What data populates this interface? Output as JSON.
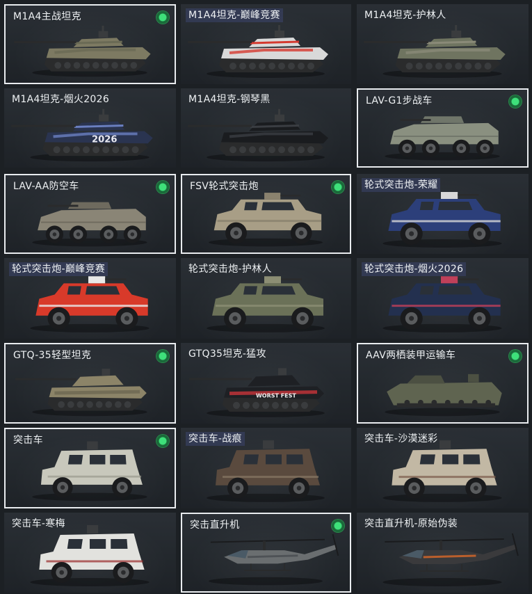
{
  "vehicles": [
    {
      "name": "M1A4主战坦克",
      "type": "tank",
      "owned": true,
      "selected": true,
      "special": false,
      "color": "#7d7a62",
      "accent": "#6a6a55"
    },
    {
      "name": "M1A4坦克-巅峰竞赛",
      "type": "tank",
      "owned": false,
      "selected": false,
      "special": true,
      "color": "#d9d9d9",
      "accent": "#d43a2f"
    },
    {
      "name": "M1A4坦克-护林人",
      "type": "tank",
      "owned": false,
      "selected": false,
      "special": false,
      "color": "#6f7460",
      "accent": "#8a8a78"
    },
    {
      "name": "M1A4坦克-烟火2026",
      "type": "tank",
      "owned": false,
      "selected": false,
      "special": false,
      "color": "#2a3450",
      "accent": "#6a7fc0",
      "decal": "2026"
    },
    {
      "name": "M1A4坦克-钢琴黑",
      "type": "tank",
      "owned": false,
      "selected": false,
      "special": false,
      "color": "#1a1c1f",
      "accent": "#3a3d42"
    },
    {
      "name": "LAV-G1步战车",
      "type": "apc8",
      "owned": true,
      "selected": true,
      "special": false,
      "color": "#8a9080",
      "accent": "#70766a"
    },
    {
      "name": "LAV-AA防空车",
      "type": "apc8",
      "owned": true,
      "selected": true,
      "special": false,
      "color": "#8a8576",
      "accent": "#6e6a5e"
    },
    {
      "name": "FSV轮式突击炮",
      "type": "armored4",
      "owned": true,
      "selected": true,
      "special": false,
      "color": "#a89e86",
      "accent": "#8a826e"
    },
    {
      "name": "轮式突击炮-荣耀",
      "type": "armored4",
      "owned": false,
      "selected": false,
      "special": true,
      "color": "#2c3f7a",
      "accent": "#d8d8d8"
    },
    {
      "name": "轮式突击炮-巅峰竞赛",
      "type": "armored4",
      "owned": false,
      "selected": false,
      "special": true,
      "color": "#d83a2a",
      "accent": "#e8e8e8"
    },
    {
      "name": "轮式突击炮-护林人",
      "type": "armored4",
      "owned": false,
      "selected": false,
      "special": false,
      "color": "#6b7158",
      "accent": "#8c8e74"
    },
    {
      "name": "轮式突击炮-烟火2026",
      "type": "armored4",
      "owned": false,
      "selected": false,
      "special": true,
      "color": "#23304f",
      "accent": "#c0405a"
    },
    {
      "name": "GTQ-35轻型坦克",
      "type": "lighttank",
      "owned": true,
      "selected": true,
      "special": false,
      "color": "#8c8468",
      "accent": "#6e6852"
    },
    {
      "name": "GTQ35坦克-猛攻",
      "type": "lighttank",
      "owned": false,
      "selected": false,
      "special": false,
      "color": "#1e2024",
      "accent": "#c8343a",
      "decal": "WORST FEST"
    },
    {
      "name": "AAV两栖装甲运输车",
      "type": "amphib",
      "owned": true,
      "selected": true,
      "special": false,
      "color": "#5f6450",
      "accent": "#4c5042"
    },
    {
      "name": "突击车",
      "type": "mrap",
      "owned": true,
      "selected": true,
      "special": false,
      "color": "#c8c8bc",
      "accent": "#9a9a8e"
    },
    {
      "name": "突击车-战痕",
      "type": "mrap",
      "owned": false,
      "selected": false,
      "special": true,
      "color": "#5a4a3e",
      "accent": "#8a7a66"
    },
    {
      "name": "突击车-沙漠迷彩",
      "type": "mrap",
      "owned": false,
      "selected": false,
      "special": false,
      "color": "#c2b8a4",
      "accent": "#7a5a4a"
    },
    {
      "name": "突击车-寒梅",
      "type": "mrap",
      "owned": false,
      "selected": false,
      "special": false,
      "color": "#e2e2de",
      "accent": "#9a2a2a"
    },
    {
      "name": "突击直升机",
      "type": "heli",
      "owned": true,
      "selected": true,
      "special": false,
      "color": "#6a6e70",
      "accent": "#4a4e52"
    },
    {
      "name": "突击直升机-原始伪装",
      "type": "heli",
      "owned": false,
      "selected": false,
      "special": false,
      "color": "#3a3a3c",
      "accent": "#d2662a"
    }
  ]
}
